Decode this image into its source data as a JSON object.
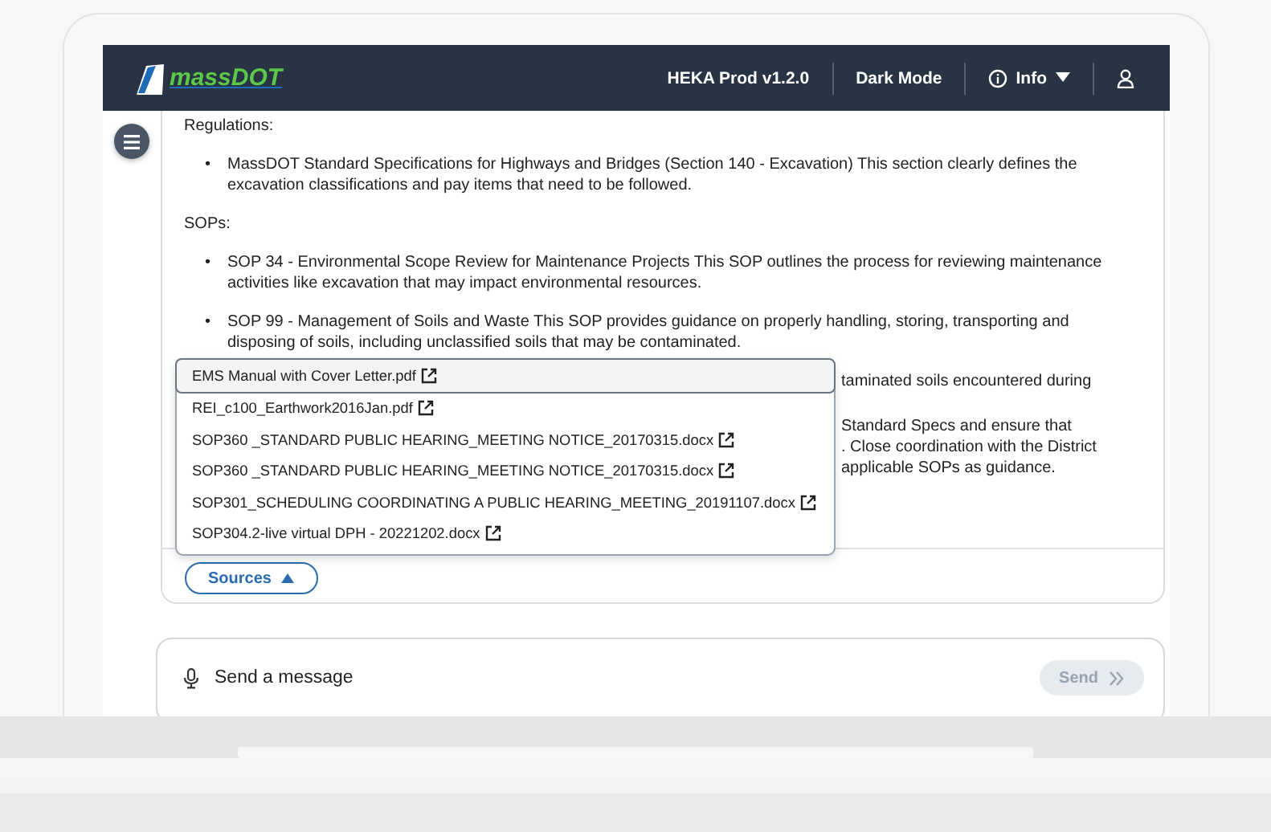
{
  "header": {
    "logo_text": "massDOT",
    "items": [
      {
        "kind": "text",
        "label": "HEKA Prod v1.2.0"
      },
      {
        "kind": "text",
        "label": "Dark Mode"
      },
      {
        "kind": "menu",
        "label": "Info"
      },
      {
        "kind": "user"
      }
    ]
  },
  "sections": [
    {
      "heading": "Regulations:",
      "bullets": [
        {
          "marker": "•",
          "text": "MassDOT Standard Specifications for Highways and Bridges (Section 140 - Excavation) This section clearly defines the excavation classifications and pay items that need to be followed."
        }
      ]
    },
    {
      "heading": "SOPs:",
      "bullets": [
        {
          "marker": "•",
          "text": "SOP 34 - Environmental Scope Review for Maintenance Projects This SOP outlines the process for reviewing maintenance activities like excavation that may impact environmental resources."
        },
        {
          "marker": "•",
          "text": "SOP 99 - Management of Soils and Waste This SOP provides guidance on properly handling, storing, transporting and disposing of soils, including unclassified soils that may be contaminated."
        }
      ]
    }
  ],
  "partly_hidden_text": [
    {
      "lines": [
        "taminated soils encountered during"
      ]
    },
    {
      "lines": [
        "Standard Specs and ensure that",
        ". Close coordination with the District",
        "applicable SOPs as guidance."
      ]
    }
  ],
  "sources": {
    "label": "Sources",
    "expanded": true,
    "files": [
      {
        "name": "EMS Manual with Cover Letter.pdf",
        "selected": true
      },
      {
        "name": "REI_c100_Earthwork2016Jan.pdf",
        "selected": false
      },
      {
        "name": "SOP360 _STANDARD PUBLIC HEARING_MEETING NOTICE_20170315.docx",
        "selected": false
      },
      {
        "name": "SOP360 _STANDARD PUBLIC HEARING_MEETING NOTICE_20170315.docx",
        "selected": false
      },
      {
        "name": "SOP301_SCHEDULING COORDINATING A PUBLIC HEARING_MEETING_20191107.docx",
        "selected": false
      },
      {
        "name": "SOP304.2-live virtual DPH - 20221202.docx",
        "selected": false
      }
    ]
  },
  "composer": {
    "placeholder": "Send a message",
    "send": {
      "label": "Send",
      "disabled": true
    }
  }
}
